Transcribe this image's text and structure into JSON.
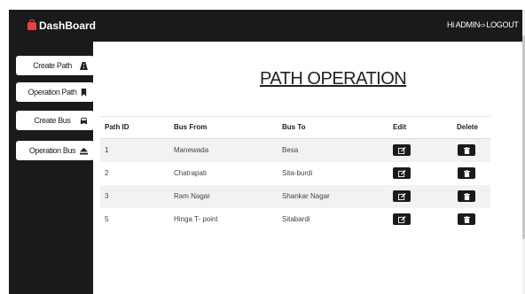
{
  "header": {
    "brand": "DashBoard",
    "greeting": "Hi ADMIN",
    "logout": "LOGOUT"
  },
  "sidebar": {
    "items": [
      {
        "label": "Create Path",
        "icon": "road-icon"
      },
      {
        "label": "Operation Path",
        "icon": "bookmark-icon"
      },
      {
        "label": "Create Bus",
        "icon": "car-icon"
      },
      {
        "label": "Operation Bus",
        "icon": "eject-icon"
      }
    ]
  },
  "main": {
    "title": "PATH OPERATION",
    "columns": [
      "Path ID",
      "Bus From",
      "Bus To",
      "Edit",
      "Delete"
    ],
    "rows": [
      {
        "id": "1",
        "from": "Manewada",
        "to": "Besa"
      },
      {
        "id": "2",
        "from": "Chatrapati",
        "to": "Sita-burdi"
      },
      {
        "id": "3",
        "from": "Ram Nagar",
        "to": "Shankar Nagar"
      },
      {
        "id": "5",
        "from": "Hinga T- point",
        "to": "Sitabardi"
      }
    ]
  },
  "colors": {
    "dark": "#1a1a1a",
    "brand_icon": "#e64040",
    "stripe": "#f2f2f2"
  }
}
